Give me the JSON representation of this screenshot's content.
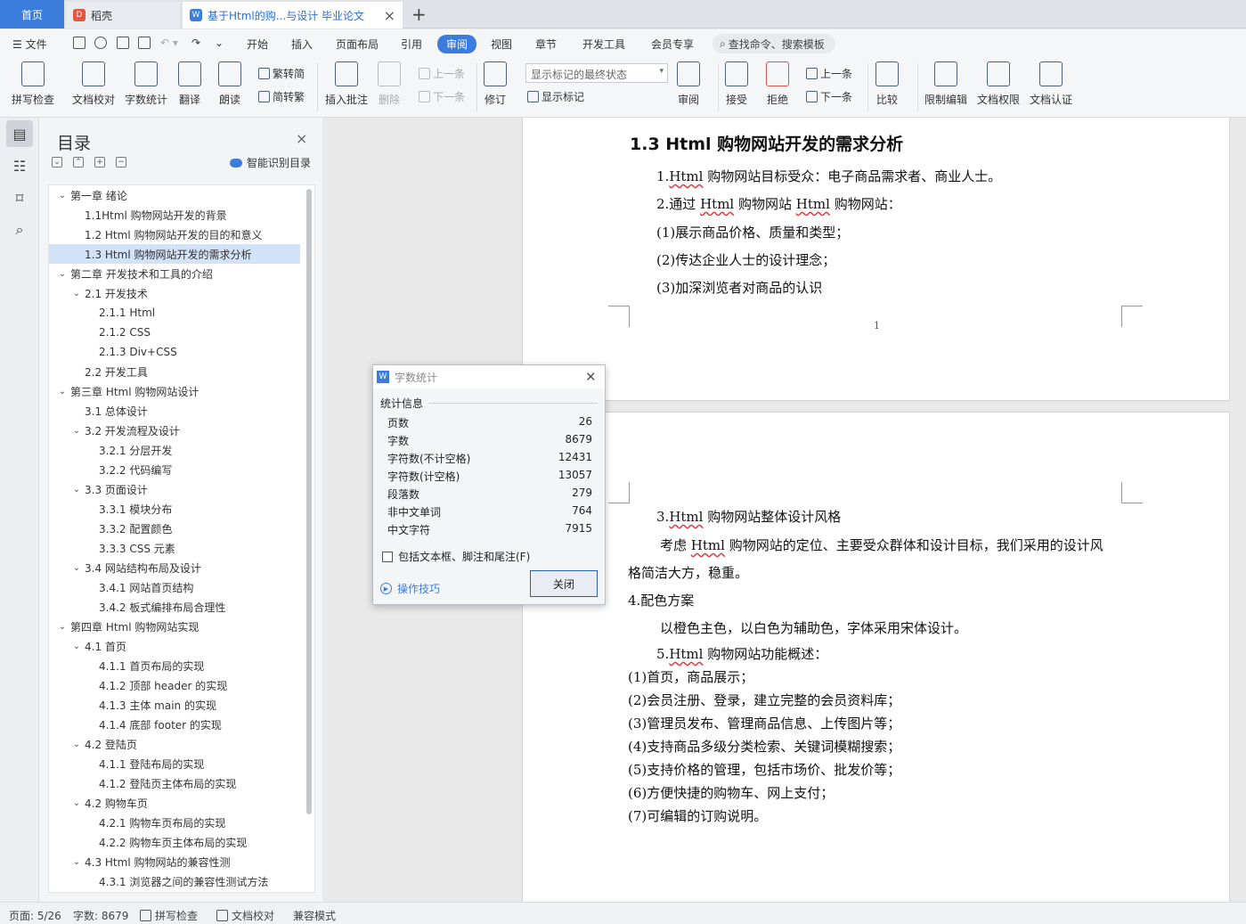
{
  "tabs": {
    "home": "首页",
    "daoke": "稻壳",
    "doc": "基于Html的购...与设计 毕业论文"
  },
  "menu": {
    "file": "文件",
    "items": [
      "开始",
      "插入",
      "页面布局",
      "引用",
      "审阅",
      "视图",
      "章节",
      "开发工具",
      "会员专享"
    ],
    "active": "审阅",
    "search": "查找命令、搜索模板"
  },
  "ribbon": {
    "spell": "拼写检查",
    "proof": "文档校对",
    "wordcount": "字数统计",
    "translate": "翻译",
    "read": "朗读",
    "to_trad": "繁转简",
    "to_simp": "简转繁",
    "insert_comment": "插入批注",
    "delete": "删除",
    "prev_comment": "上一条",
    "next_comment": "下一条",
    "revise": "修订",
    "markup_dropdown": "显示标记的最终状态",
    "show_markup": "显示标记",
    "review": "审阅",
    "accept": "接受",
    "reject": "拒绝",
    "prev_change": "上一条",
    "next_change": "下一条",
    "compare": "比较",
    "restrict": "限制编辑",
    "permission": "文档权限",
    "certify": "文档认证"
  },
  "toc": {
    "title": "目录",
    "ai": "智能识别目录",
    "items": [
      {
        "text": "第一章  绪论",
        "level": 0,
        "arrow": true
      },
      {
        "text": "1.1Html 购物网站开发的背景",
        "level": 1,
        "arrow": false
      },
      {
        "text": "1.2 Html 购物网站开发的目的和意义",
        "level": 1,
        "arrow": false
      },
      {
        "text": "1.3 Html 购物网站开发的需求分析",
        "level": 1,
        "arrow": false,
        "selected": true
      },
      {
        "text": "第二章  开发技术和工具的介绍",
        "level": 0,
        "arrow": true
      },
      {
        "text": "2.1 开发技术",
        "level": 1,
        "arrow": true
      },
      {
        "text": "2.1.1 Html",
        "level": 2,
        "arrow": false
      },
      {
        "text": "2.1.2 CSS",
        "level": 2,
        "arrow": false
      },
      {
        "text": "2.1.3 Div+CSS",
        "level": 2,
        "arrow": false
      },
      {
        "text": "2.2 开发工具",
        "level": 1,
        "arrow": false
      },
      {
        "text": "第三章  Html 购物网站设计",
        "level": 0,
        "arrow": true
      },
      {
        "text": "3.1 总体设计",
        "level": 1,
        "arrow": false
      },
      {
        "text": "3.2 开发流程及设计",
        "level": 1,
        "arrow": true
      },
      {
        "text": "3.2.1  分层开发",
        "level": 2,
        "arrow": false
      },
      {
        "text": "3.2.2  代码编写",
        "level": 2,
        "arrow": false
      },
      {
        "text": "3.3 页面设计",
        "level": 1,
        "arrow": true
      },
      {
        "text": "3.3.1 模块分布",
        "level": 2,
        "arrow": false
      },
      {
        "text": "3.3.2  配置颜色",
        "level": 2,
        "arrow": false
      },
      {
        "text": "3.3.3 CSS 元素",
        "level": 2,
        "arrow": false
      },
      {
        "text": "3.4 网站结构布局及设计",
        "level": 1,
        "arrow": true
      },
      {
        "text": "3.4.1  网站首页结构",
        "level": 2,
        "arrow": false
      },
      {
        "text": "3.4.2  板式编排布局合理性",
        "level": 2,
        "arrow": false
      },
      {
        "text": "第四章  Html 购物网站实现",
        "level": 0,
        "arrow": true
      },
      {
        "text": "4.1 首页",
        "level": 1,
        "arrow": true
      },
      {
        "text": "4.1.1 首页布局的实现",
        "level": 2,
        "arrow": false
      },
      {
        "text": "4.1.2  顶部 header 的实现",
        "level": 2,
        "arrow": false
      },
      {
        "text": "4.1.3  主体 main 的实现",
        "level": 2,
        "arrow": false
      },
      {
        "text": "4.1.4  底部 footer 的实现",
        "level": 2,
        "arrow": false
      },
      {
        "text": "4.2  登陆页",
        "level": 1,
        "arrow": true
      },
      {
        "text": "4.1.1 登陆布局的实现",
        "level": 2,
        "arrow": false
      },
      {
        "text": "4.1.2 登陆页主体布局的实现",
        "level": 2,
        "arrow": false
      },
      {
        "text": "4.2  购物车页",
        "level": 1,
        "arrow": true
      },
      {
        "text": "4.2.1 购物车页布局的实现",
        "level": 2,
        "arrow": false
      },
      {
        "text": "4.2.2 购物车页主体布局的实现",
        "level": 2,
        "arrow": false
      },
      {
        "text": "4.3 Html 购物网站的兼容性测",
        "level": 1,
        "arrow": true
      },
      {
        "text": "4.3.1 浏览器之间的兼容性测试方法",
        "level": 2,
        "arrow": false
      }
    ]
  },
  "document": {
    "page1": {
      "heading": "1.3 Html 购物网站开发的需求分析",
      "lines": [
        "1.Html 购物网站目标受众：电子商品需求者、商业人士。",
        "2.通过 Html 购物网站 Html 购物网站：",
        "(1)展示商品价格、质量和类型；",
        "(2)传达企业人士的设计理念；",
        "(3)加深浏览者对商品的认识"
      ],
      "page_number": "1"
    },
    "page2": {
      "lines": [
        "3.Html 购物网站整体设计风格",
        "考虑 Html 购物网站的定位、主要受众群体和设计目标，我们采用的设计风",
        "格简洁大方，稳重。",
        "4.配色方案",
        "以橙色主色，以白色为辅助色，字体采用宋体设计。",
        "5.Html 购物网站功能概述：",
        "(1)首页，商品展示；",
        "(2)会员注册、登录，建立完整的会员资料库；",
        "(3)管理员发布、管理商品信息、上传图片等；",
        "(4)支持商品多级分类检索、关键词模糊搜索；",
        "(5)支持价格的管理，包括市场价、批发价等；",
        "(6)方便快捷的购物车、网上支付；",
        "(7)可编辑的订购说明。"
      ]
    }
  },
  "dialog": {
    "title": "字数统计",
    "section": "统计信息",
    "stats": [
      {
        "label": "页数",
        "value": "26"
      },
      {
        "label": "字数",
        "value": "8679"
      },
      {
        "label": "字符数(不计空格)",
        "value": "12431"
      },
      {
        "label": "字符数(计空格)",
        "value": "13057"
      },
      {
        "label": "段落数",
        "value": "279"
      },
      {
        "label": "非中文单词",
        "value": "764"
      },
      {
        "label": "中文字符",
        "value": "7915"
      }
    ],
    "checkbox": "包括文本框、脚注和尾注(F)",
    "tips": "操作技巧",
    "close": "关闭"
  },
  "status": {
    "page": "页面: 5/26",
    "words": "字数: 8679",
    "spell": "拼写检查",
    "proof": "文档校对",
    "compat": "兼容模式"
  },
  "colors": {
    "accent": "#3b7ddd",
    "toc_selected": "#d2e2f7",
    "spell_underline": "#e03a3a"
  }
}
